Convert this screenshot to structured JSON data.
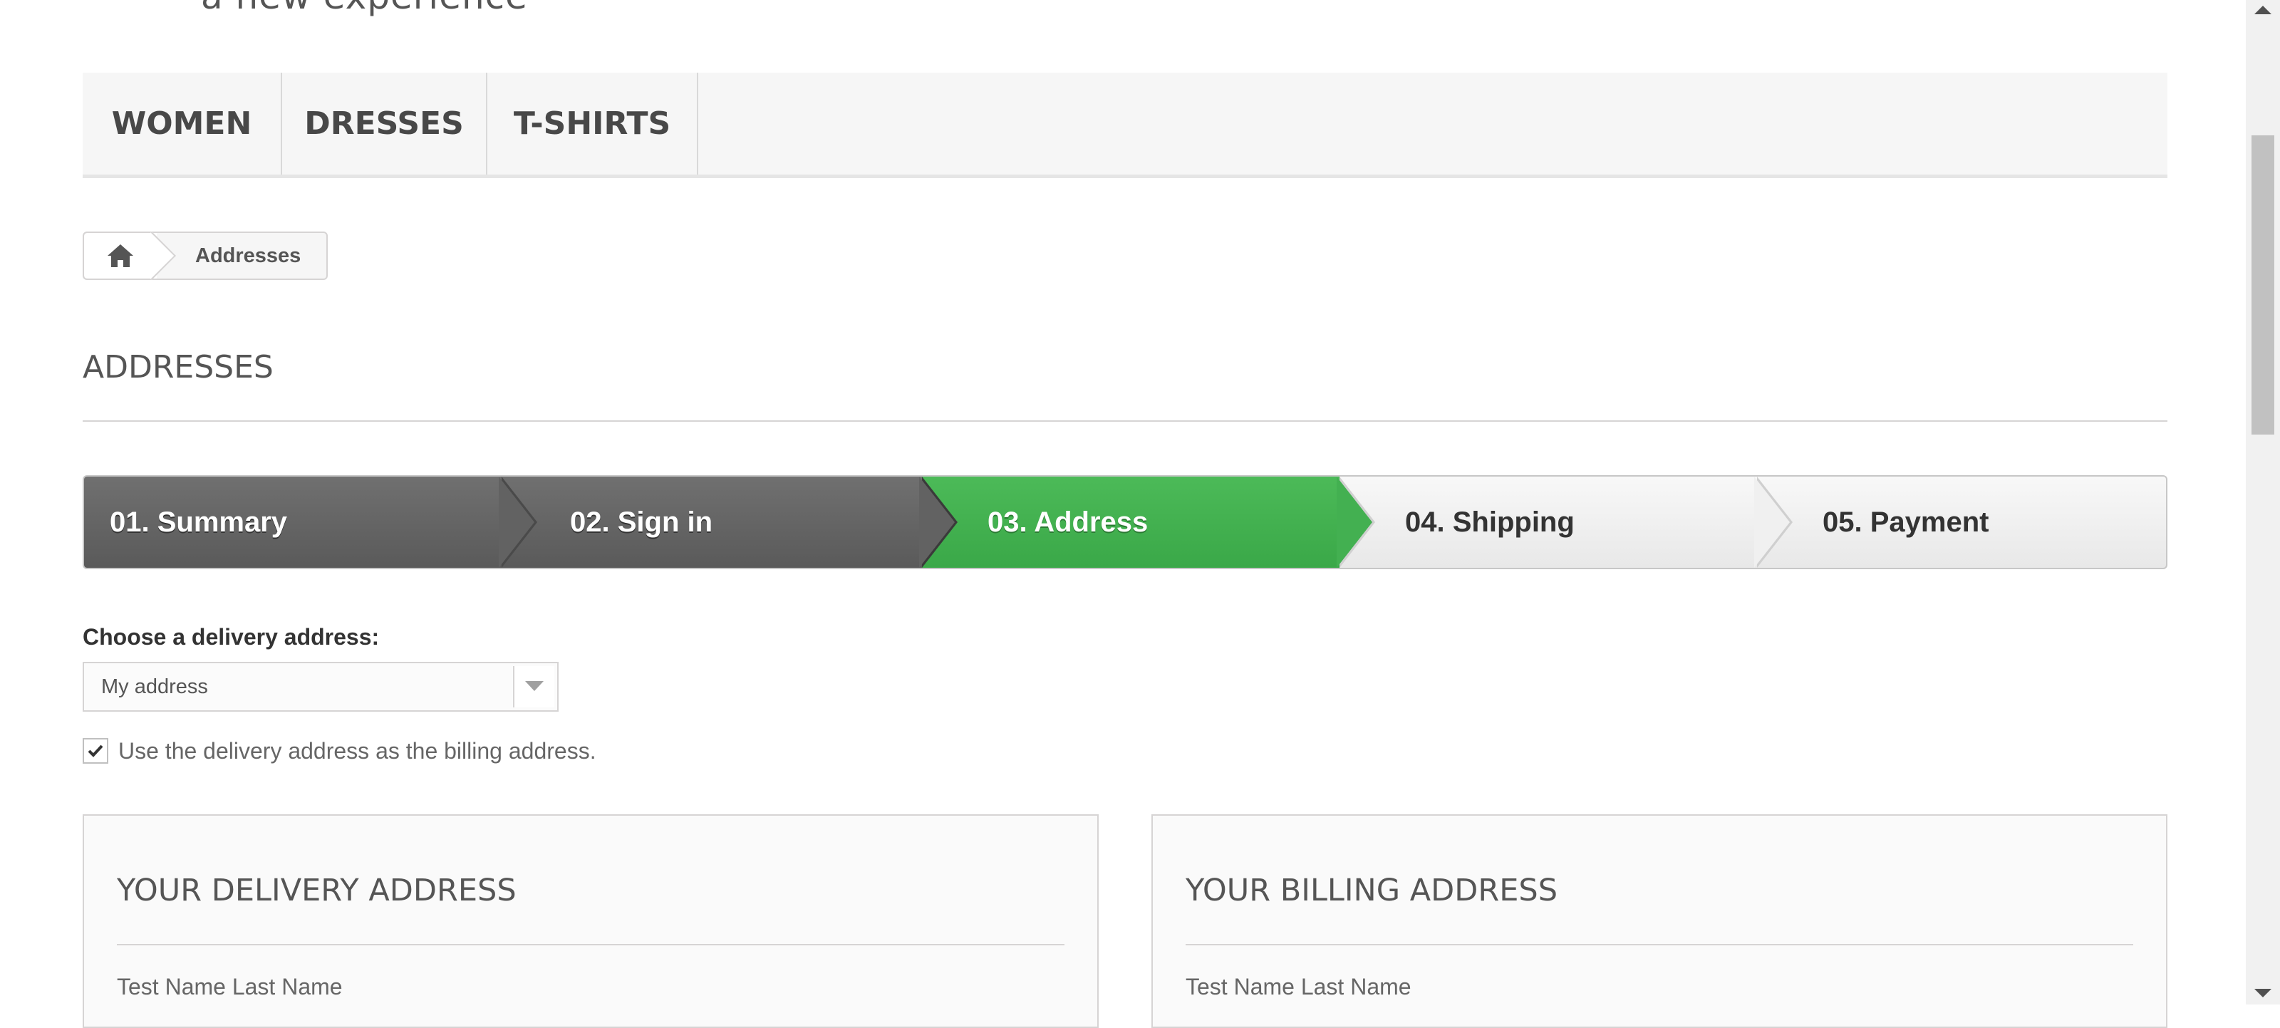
{
  "banner": {
    "text": "a new experience"
  },
  "menu": {
    "items": [
      {
        "label": "WOMEN"
      },
      {
        "label": "DRESSES"
      },
      {
        "label": "T-SHIRTS"
      }
    ]
  },
  "breadcrumb": {
    "home_icon": "home-icon",
    "current": "Addresses"
  },
  "page": {
    "heading": "ADDRESSES"
  },
  "steps": [
    {
      "label": "01. Summary",
      "state": "done"
    },
    {
      "label": "02. Sign in",
      "state": "done"
    },
    {
      "label": "03. Address",
      "state": "current"
    },
    {
      "label": "04. Shipping",
      "state": "todo"
    },
    {
      "label": "05. Payment",
      "state": "todo"
    }
  ],
  "delivery": {
    "choose_label": "Choose a delivery address:",
    "selected": "My address",
    "same_as_billing": true,
    "same_as_billing_label": "Use the delivery address as the billing address."
  },
  "delivery_box": {
    "title": "YOUR DELIVERY ADDRESS",
    "name": "Test Name Last Name"
  },
  "billing_box": {
    "title": "YOUR BILLING ADDRESS",
    "name": "Test Name Last Name"
  },
  "colors": {
    "accent": "#46b254",
    "done": "#666666",
    "border": "#d6d4d4"
  }
}
